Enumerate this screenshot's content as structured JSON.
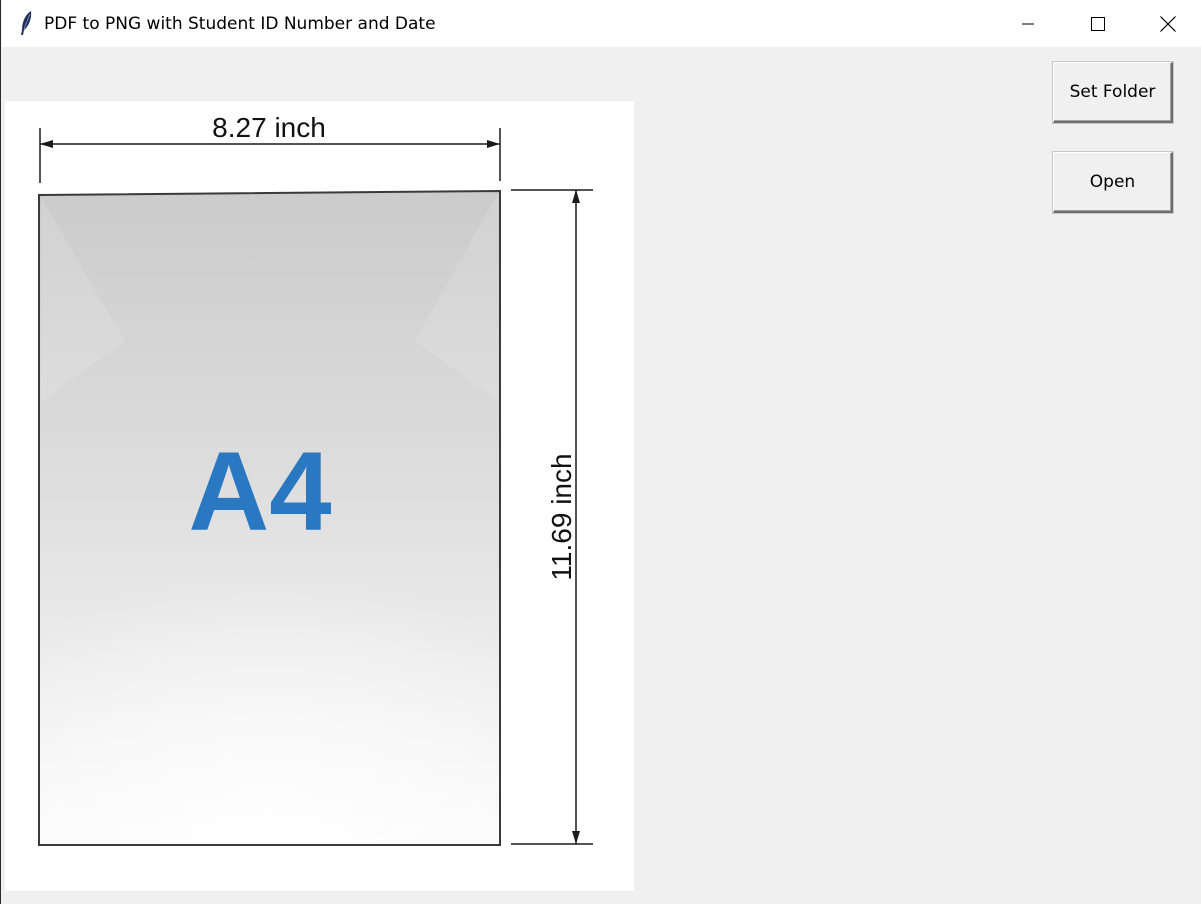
{
  "window": {
    "title": "PDF to PNG with Student ID Number and Date",
    "app_icon": "feather-icon",
    "controls": [
      "minimize-icon",
      "maximize-icon",
      "close-icon"
    ]
  },
  "buttons": {
    "set_folder": "Set Folder",
    "open": "Open"
  },
  "preview": {
    "paper_label": "A4",
    "width_label": "8.27 inch",
    "height_label": "11.69 inch",
    "label_color": "#2b78c2",
    "dimension_line_color": "#1a1a1a"
  }
}
